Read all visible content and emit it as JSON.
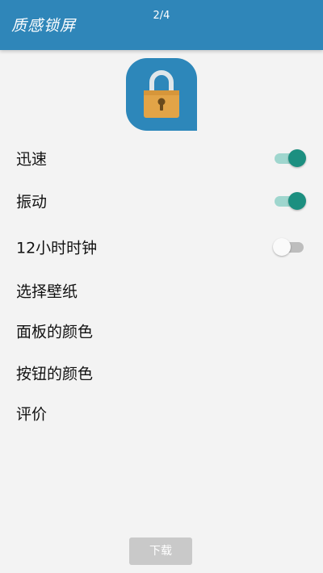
{
  "app_bar": {
    "title": "质感锁屏",
    "page_indicator": "2/4",
    "color": "#2f86b9"
  },
  "app_icon": {
    "icon": "padlock-icon",
    "background": "#2d87ba",
    "lock_color": "#e2a447"
  },
  "settings": [
    {
      "label": "迅速",
      "toggle": true
    },
    {
      "label": "振动",
      "toggle": true
    },
    {
      "label": "12小时时钟",
      "toggle": false
    },
    {
      "label": "选择壁纸"
    },
    {
      "label": "面板的颜色"
    },
    {
      "label": "按钮的颜色"
    },
    {
      "label": "评价"
    }
  ],
  "toggle_on_color": "#1c8f80",
  "download_button": {
    "label": "下载"
  }
}
